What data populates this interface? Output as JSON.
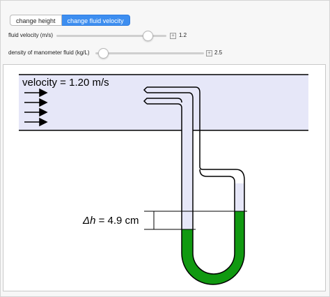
{
  "tabs": [
    {
      "label": "change height",
      "active": false
    },
    {
      "label": "change fluid velocity",
      "active": true
    }
  ],
  "controls": {
    "velocity": {
      "label": "fluid velocity (m/s)",
      "value": "1.2"
    },
    "density": {
      "label": "density of manometer fluid (kg/L)",
      "value": "2.5"
    }
  },
  "canvas": {
    "velocity_prefix": "velocity = ",
    "velocity_value": "1.20 m/s",
    "dh_symbol": "Δh",
    "dh_value": " = 4.9 cm",
    "colors": {
      "flow_region": "#e6e7f8",
      "tube_fill": "#e6e7f8",
      "manometer_fluid": "#119911"
    }
  }
}
